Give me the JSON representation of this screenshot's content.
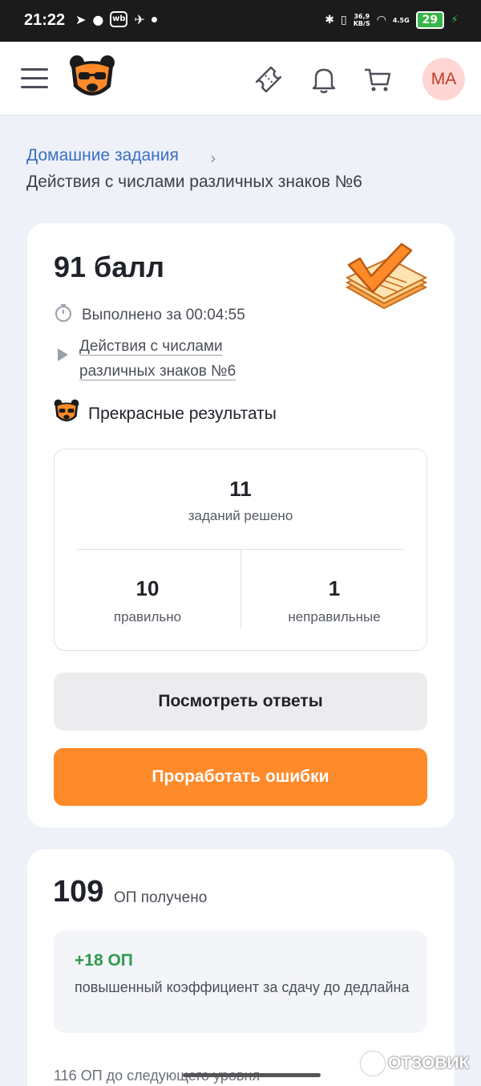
{
  "status_bar": {
    "time": "21:22",
    "net_speed_value": "36,9",
    "net_speed_unit": "KB/S",
    "network": "4.5G",
    "battery": "29"
  },
  "header": {
    "avatar_initials": "МА",
    "icons": [
      "menu-icon",
      "bear-logo",
      "ticket-icon",
      "bell-icon",
      "cart-icon"
    ]
  },
  "breadcrumb": {
    "parent": "Домашние задания",
    "current": "Действия с числами различных знаков №6"
  },
  "result": {
    "score": "91 балл",
    "time_spent": "Выполнено за 00:04:55",
    "task_title": "Действия с числами различных знаков №6",
    "verdict": "Прекрасные результаты",
    "solved_count": "11",
    "solved_label": "заданий решено",
    "correct_count": "10",
    "correct_label": "правильно",
    "wrong_count": "1",
    "wrong_label": "неправильные",
    "view_answers_button": "Посмотреть ответы",
    "work_on_mistakes_button": "Проработать ошибки"
  },
  "points": {
    "total": "109",
    "total_label": "ОП получено",
    "bonus_value": "+18 ОП",
    "bonus_description": "повышенный коэффициент за сдачу до дедлайна",
    "next_level": "116 ОП до следующего уровня"
  },
  "watermark": "ОТЗОВИК",
  "colors": {
    "accent_orange": "#ff8a2a",
    "link_blue": "#3a6fc4",
    "bonus_green": "#2e9b4f",
    "avatar_bg": "#ffd6d3"
  }
}
